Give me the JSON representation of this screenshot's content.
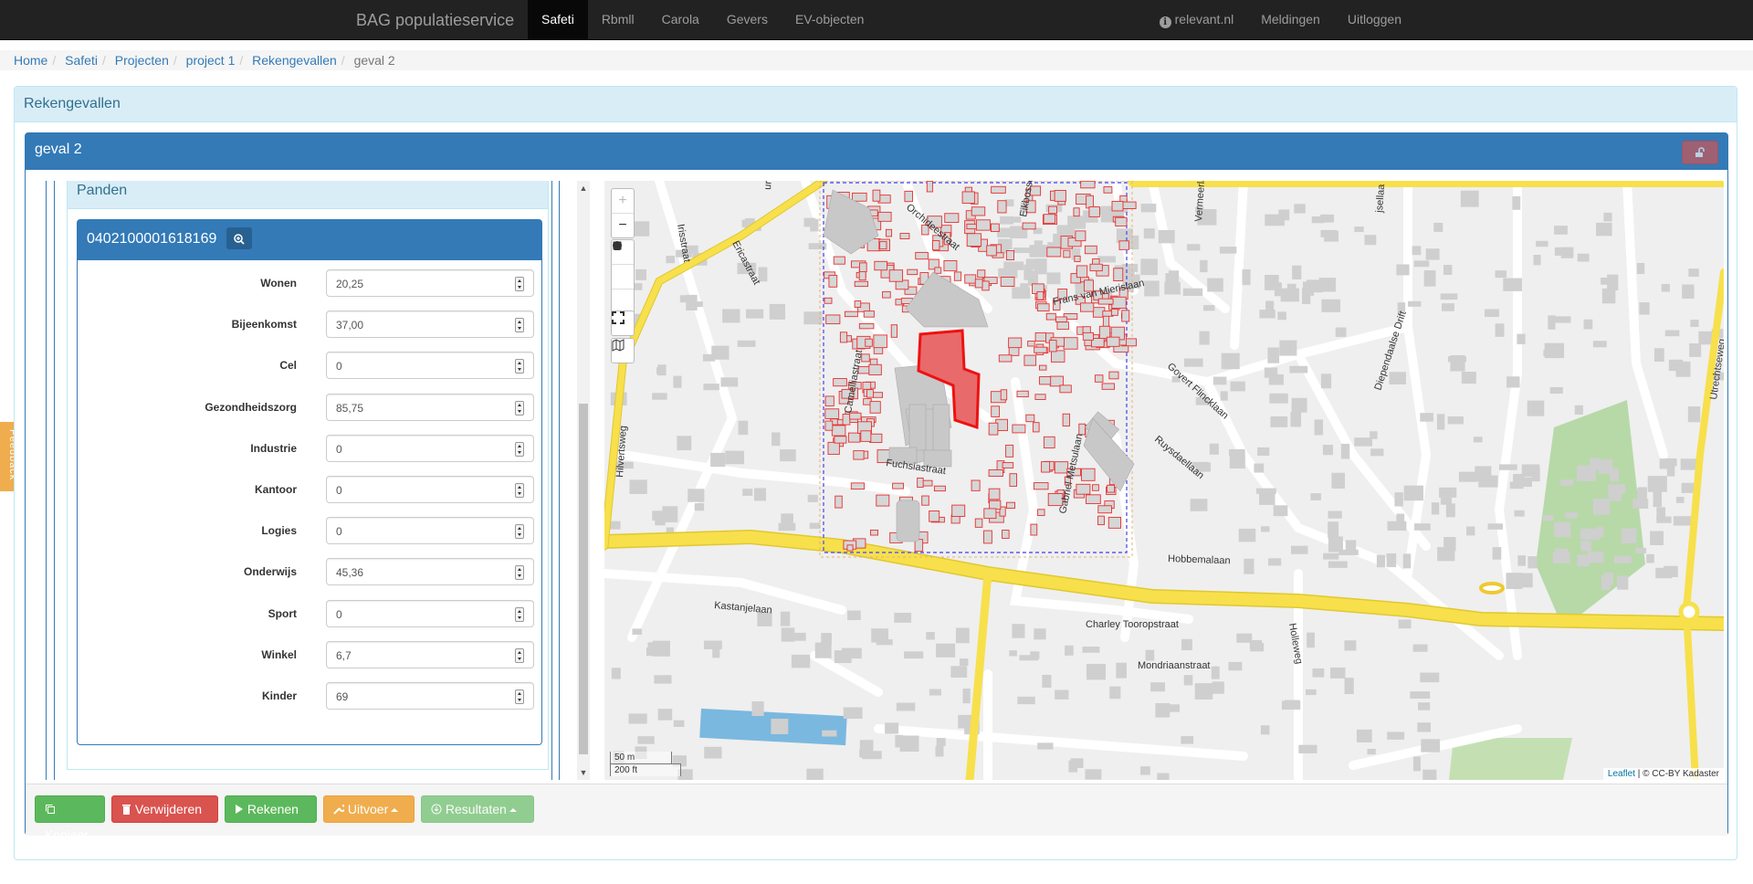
{
  "navbar": {
    "brand": "BAG populatieservice",
    "items": [
      "Safeti",
      "Rbmll",
      "Carola",
      "Gevers",
      "EV-objecten"
    ],
    "right": {
      "relevant": "relevant.nl",
      "meldingen": "Meldingen",
      "uitloggen": "Uitloggen"
    }
  },
  "breadcrumb": [
    "Home",
    "Safeti",
    "Projecten",
    "project 1",
    "Rekengevallen",
    "geval 2"
  ],
  "outer_panel": {
    "title": "Rekengevallen"
  },
  "inner_panel": {
    "title": "geval 2"
  },
  "panden": {
    "title": "Panden",
    "pand_id": "0402100001618169",
    "fields": [
      {
        "label": "Wonen",
        "value": "20,25"
      },
      {
        "label": "Bijeenkomst",
        "value": "37,00"
      },
      {
        "label": "Cel",
        "value": "0"
      },
      {
        "label": "Gezondheidszorg",
        "value": "85,75"
      },
      {
        "label": "Industrie",
        "value": "0"
      },
      {
        "label": "Kantoor",
        "value": "0"
      },
      {
        "label": "Logies",
        "value": "0"
      },
      {
        "label": "Onderwijs",
        "value": "45,36"
      },
      {
        "label": "Sport",
        "value": "0"
      },
      {
        "label": "Winkel",
        "value": "6,7"
      },
      {
        "label": "Kinder",
        "value": "69"
      }
    ]
  },
  "map": {
    "streets": {
      "hilvertsweg": "Hilvertsweg",
      "ericastraat": "Ericastraat",
      "irisstraat": "Irisstraat",
      "orchideestraat": "Orchideestraat",
      "eikbosse": "Eikbosse",
      "camelliastraat": "Camelliastraat",
      "fuchsiastraat": "Fuchsiastraat",
      "frans": "Frans van Mierislaan",
      "govert": "Govert Flincklaan",
      "ruysdael": "Ruysdaellaan",
      "gabriel": "Gabriel Metsulaan",
      "hobbema": "Hobbemalaan",
      "kastanje": "Kastanjelaan",
      "charley": "Charley Tooropstraat",
      "mondriaan": "Mondriaanstraat",
      "hollewe": "Holleweg",
      "diepen": "Diependaalse Drift",
      "utrecht": "Utrechtseweg",
      "vermeer": "Vermeerla",
      "jsel": "jsellaa",
      "ur": "ur"
    },
    "scale_m": "50 m",
    "scale_ft": "200 ft",
    "attribution_link": "Leaflet",
    "attribution_text": " | © CC-BY Kadaster",
    "zoom_in": "+",
    "zoom_out": "−",
    "colors": {
      "selected": "#e74c4c",
      "outline": "#e83030",
      "road_main": "#f7e04b",
      "building": "#c8c8c8",
      "water": "#7ab8e0",
      "green": "#b7d9a8"
    }
  },
  "actions": {
    "kopieer": "Kopieer",
    "verwijderen": "Verwijderen",
    "rekenen": "Rekenen",
    "uitvoer": "Uitvoer",
    "resultaten": "Resultaten"
  },
  "feedback": "Feedback"
}
